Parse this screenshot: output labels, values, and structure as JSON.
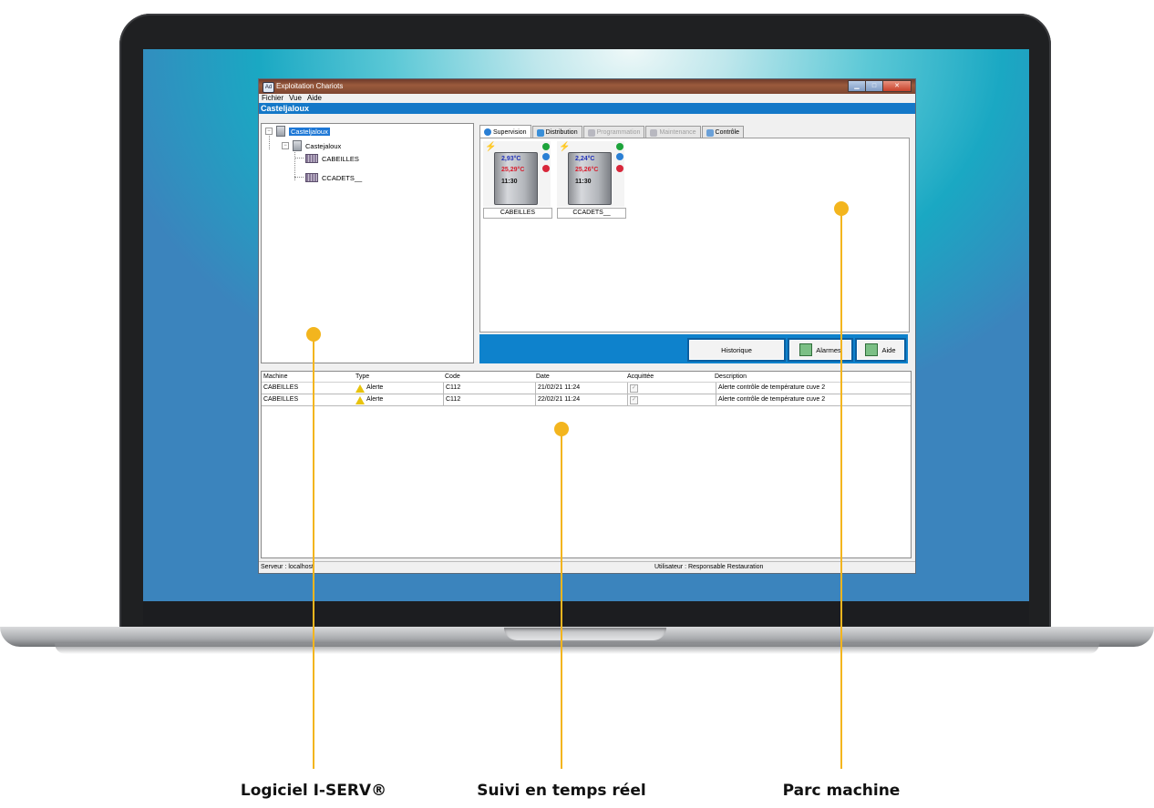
{
  "window": {
    "title": "Exploitation Chariots",
    "app_icon": "Ad",
    "menu": [
      "Fichier",
      "Vue",
      "Aide"
    ],
    "site_header": "Casteljaloux"
  },
  "tree": {
    "root": "Casteljaloux",
    "group": "Castejaloux",
    "items": [
      "CABEILLES",
      "CCADETS__"
    ]
  },
  "tabs": [
    {
      "label": "Supervision",
      "state": "active"
    },
    {
      "label": "Distribution",
      "state": "enabled"
    },
    {
      "label": "Programmation",
      "state": "disabled"
    },
    {
      "label": "Maintenance",
      "state": "disabled"
    },
    {
      "label": "Contrôle",
      "state": "enabled"
    }
  ],
  "carts": [
    {
      "name": "CABEILLES",
      "cold_temp": "2,93°C",
      "hot_temp": "25,29°C",
      "time": "11:30",
      "status_color": "#1ca33a"
    },
    {
      "name": "CCADETS__",
      "cold_temp": "2,24°C",
      "hot_temp": "25,26°C",
      "time": "11:30",
      "status_color": "#1ca33a"
    }
  ],
  "buttons": {
    "historique": "Historique",
    "alarmes": "Alarmes",
    "aide": "Aide"
  },
  "grid": {
    "headers": [
      "Machine",
      "Type",
      "Code",
      "Date",
      "Acquittée",
      "Description"
    ],
    "rows": [
      {
        "machine": "CABEILLES",
        "type": "Alerte",
        "code": "C112",
        "date": "21/02/21 11:24",
        "description": "Alerte contrôle de température cuve 2"
      },
      {
        "machine": "CABEILLES",
        "type": "Alerte",
        "code": "C112",
        "date": "22/02/21 11:24",
        "description": "Alerte contrôle de température cuve 2"
      }
    ]
  },
  "status": {
    "server": "Serveur : localhost",
    "user": "Utilisateur : Responsable Restauration"
  },
  "callouts": {
    "left": "Logiciel I-SERV®",
    "center": "Suivi en temps réel",
    "right": "Parc machine"
  },
  "colors": {
    "accent": "#f3b51e",
    "site_bar": "#1478c8",
    "button_bar": "#0e82cc"
  }
}
